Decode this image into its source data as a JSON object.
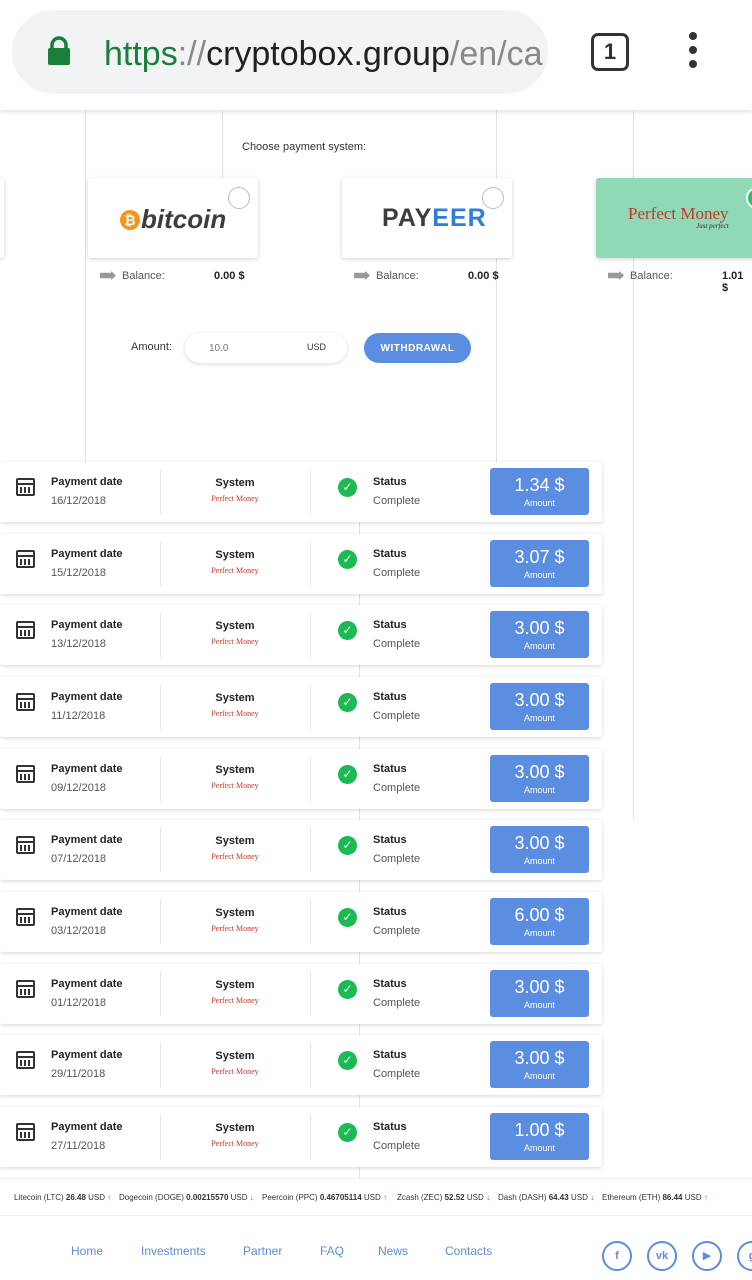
{
  "browser": {
    "url_scheme": "https",
    "url_sep": "://",
    "url_host": "cryptobox.group",
    "url_path": "/en/ca",
    "tab_count": "1"
  },
  "payment": {
    "choose_label": "Choose payment system:",
    "systems": [
      {
        "logo": "bitcoin",
        "balance_label": "Balance:",
        "balance": "0.00 $",
        "selected": false
      },
      {
        "logo": "PAYEER",
        "balance_label": "Balance:",
        "balance": "0.00 $",
        "selected": false
      },
      {
        "logo": "Perfect Money",
        "tagline": "Just perfect",
        "balance_label": "Balance:",
        "balance": "1.01 $",
        "selected": true
      }
    ],
    "amount_label": "Amount:",
    "amount_placeholder": "10.0",
    "currency": "USD",
    "withdraw_label": "WITHDRAWAL"
  },
  "history": {
    "date_label": "Payment date",
    "system_label": "System",
    "system_value": "Perfect Money",
    "status_label": "Status",
    "amount_label": "Amount",
    "rows": [
      {
        "date": "16/12/2018",
        "status": "Complete",
        "amount": "1.34 $"
      },
      {
        "date": "15/12/2018",
        "status": "Complete",
        "amount": "3.07 $"
      },
      {
        "date": "13/12/2018",
        "status": "Complete",
        "amount": "3.00 $"
      },
      {
        "date": "11/12/2018",
        "status": "Complete",
        "amount": "3.00 $"
      },
      {
        "date": "09/12/2018",
        "status": "Complete",
        "amount": "3.00 $"
      },
      {
        "date": "07/12/2018",
        "status": "Complete",
        "amount": "3.00 $"
      },
      {
        "date": "03/12/2018",
        "status": "Complete",
        "amount": "6.00 $"
      },
      {
        "date": "01/12/2018",
        "status": "Complete",
        "amount": "3.00 $"
      },
      {
        "date": "29/11/2018",
        "status": "Complete",
        "amount": "3.00 $"
      },
      {
        "date": "27/11/2018",
        "status": "Complete",
        "amount": "1.00 $"
      }
    ]
  },
  "ticker": [
    {
      "name": "Litecoin (LTC)",
      "price": "26.48",
      "unit": "USD",
      "dir": "up"
    },
    {
      "name": "Dogecoin (DOGE)",
      "price": "0.00215570",
      "unit": "USD",
      "dir": "down"
    },
    {
      "name": "Peercoin (PPC)",
      "price": "0.46705114",
      "unit": "USD",
      "dir": "up"
    },
    {
      "name": "Zcash (ZEC)",
      "price": "52.52",
      "unit": "USD",
      "dir": "down"
    },
    {
      "name": "Dash (DASH)",
      "price": "64.43",
      "unit": "USD",
      "dir": "down"
    },
    {
      "name": "Ethereum (ETH)",
      "price": "86.44",
      "unit": "USD",
      "dir": "up"
    }
  ],
  "footer": {
    "links": [
      "Home",
      "Investments",
      "Partner",
      "FAQ",
      "News",
      "Contacts"
    ],
    "social": [
      "facebook-icon",
      "vk-icon",
      "youtube-icon",
      "google-plus-icon"
    ]
  },
  "colors": {
    "accent": "#5b8de0",
    "success": "#1db954",
    "selected_card": "#8fd9b6"
  }
}
